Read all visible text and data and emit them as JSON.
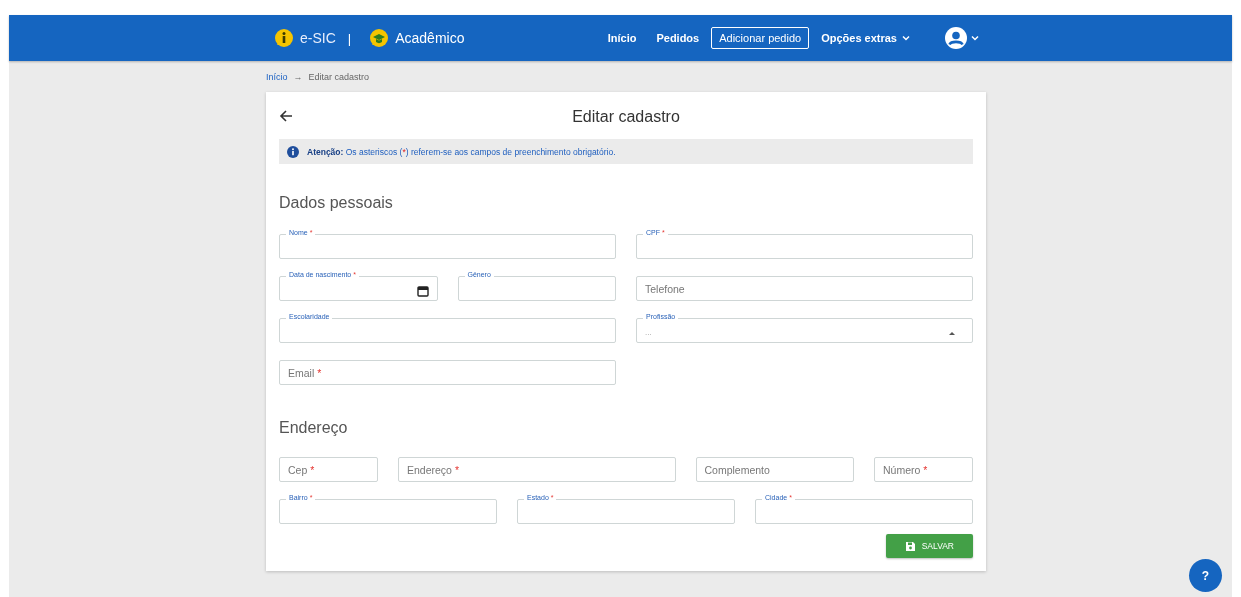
{
  "header": {
    "brand": "e-SIC",
    "separator": "|",
    "app": "Acadêmico",
    "nav": [
      {
        "label": "Início",
        "kind": "link"
      },
      {
        "label": "Pedidos",
        "kind": "link"
      },
      {
        "label": "Adicionar pedido",
        "kind": "outlined"
      },
      {
        "label": "Opções extras",
        "kind": "menu"
      }
    ]
  },
  "breadcrumb": {
    "items": [
      "Início",
      "Editar cadastro"
    ],
    "separator": "→"
  },
  "card": {
    "title": "Editar cadastro",
    "alert": {
      "parts": [
        "**Atenção:** Os asteriscos (",
        "*",
        ") referem-se aos campos de preenchimento obrigatório."
      ]
    },
    "sections": [
      {
        "heading": "Dados pessoais",
        "rows": [
          [
            {
              "label": "Nome",
              "required": true,
              "floating": true,
              "kind": "text"
            },
            {
              "label": "CPF",
              "required": true,
              "floating": true,
              "kind": "text"
            }
          ],
          [
            {
              "label": "Data de nascimento",
              "required": true,
              "floating": true,
              "kind": "date"
            },
            {
              "label": "Gênero",
              "required": false,
              "floating": true,
              "kind": "text"
            },
            {
              "label": "Telefone",
              "required": false,
              "floating": false,
              "kind": "text"
            }
          ],
          [
            {
              "label": "Escolaridade",
              "required": false,
              "floating": true,
              "kind": "text"
            },
            {
              "label": "Profissão",
              "required": false,
              "floating": true,
              "kind": "select",
              "value": "..."
            }
          ],
          [
            {
              "label": "Email",
              "required": true,
              "floating": false,
              "kind": "text"
            }
          ]
        ]
      },
      {
        "heading": "Endereço",
        "rows": [
          [
            {
              "label": "Cep",
              "required": true,
              "floating": false,
              "kind": "text"
            },
            {
              "label": "Endereço",
              "required": true,
              "floating": false,
              "kind": "text"
            },
            {
              "label": "Complemento",
              "required": false,
              "floating": false,
              "kind": "text"
            },
            {
              "label": "Número",
              "required": true,
              "floating": false,
              "kind": "text"
            }
          ],
          [
            {
              "label": "Bairro",
              "required": true,
              "floating": true,
              "kind": "text"
            },
            {
              "label": "Estado",
              "required": true,
              "floating": true,
              "kind": "text"
            },
            {
              "label": "Cidade",
              "required": true,
              "floating": true,
              "kind": "text"
            }
          ]
        ]
      }
    ],
    "save": "SALVAR"
  },
  "help": "?"
}
